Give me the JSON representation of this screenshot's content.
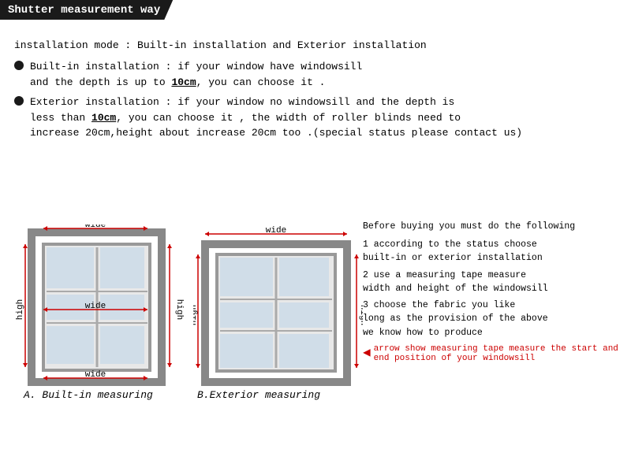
{
  "title": "Shutter measurement way",
  "installation_mode_label": "installation mode : Built-in installation and Exterior installation",
  "bullet1": {
    "text1": "Built-in installation : if your window have windowsill",
    "text2_pre": "and the depth is up to ",
    "text2_bold": "10cm",
    "text2_post": ", you can choose it ."
  },
  "bullet2": {
    "text1_pre": "Exterior installation : if your window no windowsill and the depth is",
    "text2_pre": "less than ",
    "text2_bold": "10cm",
    "text2_post": ", you can choose it , the width of roller blinds need to",
    "text3": "increase 20cm,height about increase 20cm too .(special status please contact us)"
  },
  "instructions": {
    "intro": "Before buying you must do the following",
    "step1_pre": "1 according to the status choose",
    "step1_cont": "  built-in or exterior installation",
    "step2_pre": "2 use a measuring tape measure",
    "step2_cont": "  width and height of the windowsill",
    "step3_pre": "3 choose the fabric you like",
    "step3_cont": "  long as the provision of the above",
    "step3_cont2": "  we know how to produce",
    "arrow_note": "arrow show measuring tape measure the start and end position of your windowsill"
  },
  "diagram_a_label": "A. Built-in measuring",
  "diagram_b_label": "B.Exterior measuring",
  "labels": {
    "wide": "wide",
    "high": "high"
  }
}
